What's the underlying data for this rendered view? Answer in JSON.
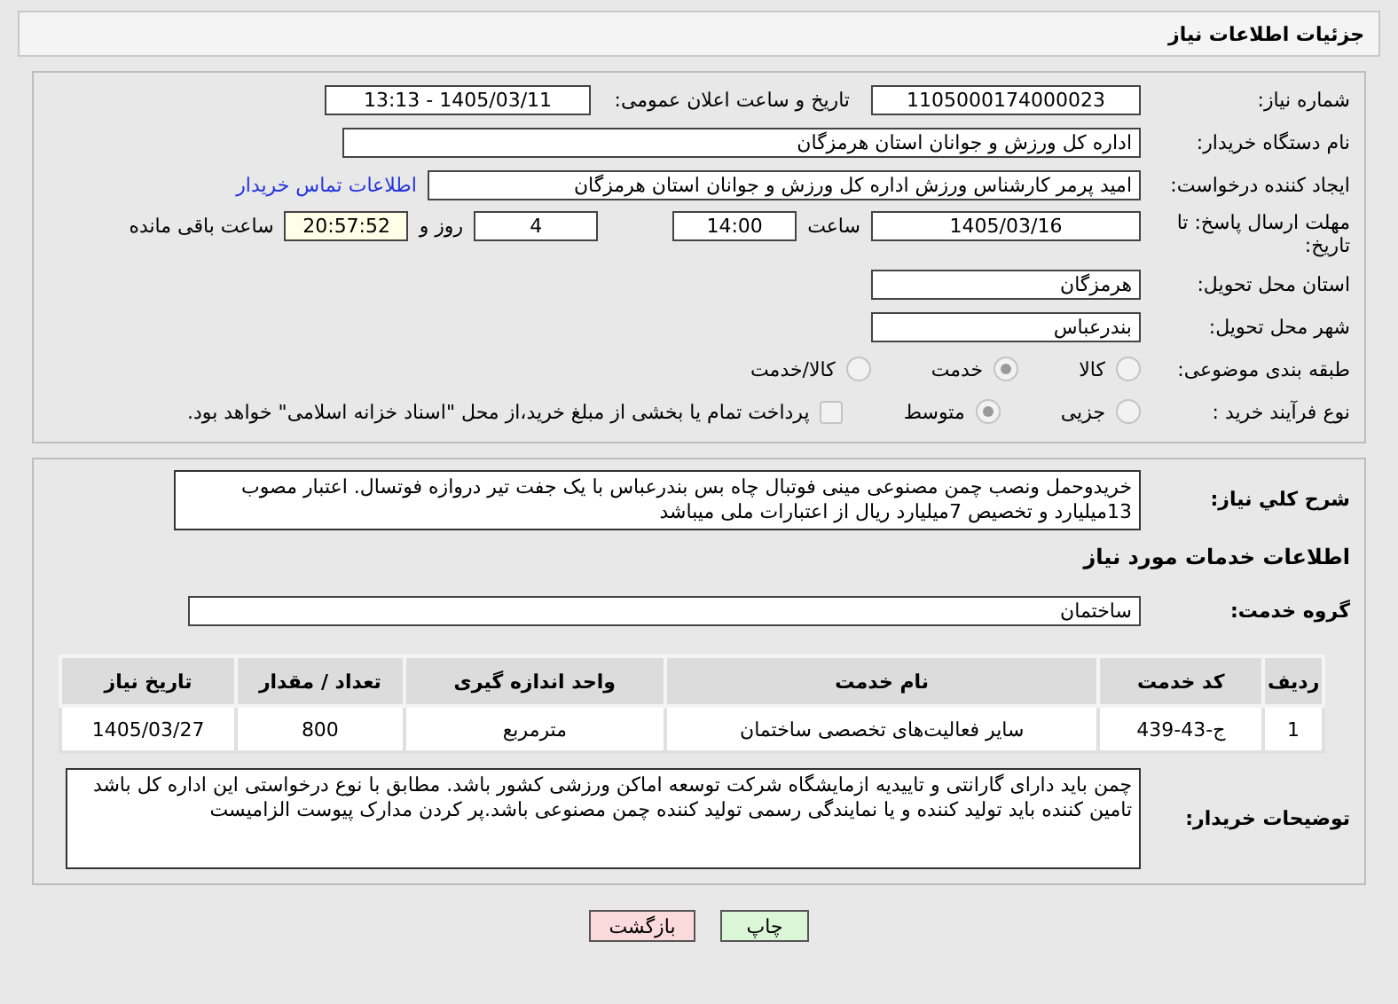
{
  "header": {
    "title": "جزئیات اطلاعات نیاز"
  },
  "need_number": {
    "label": "شماره نیاز:",
    "value": "1105000174000023"
  },
  "announce": {
    "label": "تاریخ و ساعت اعلان عمومی:",
    "value": "1405/03/11 - 13:13"
  },
  "buyer_org": {
    "label": "نام دستگاه خریدار:",
    "value": "اداره کل ورزش و جوانان استان هرمزگان"
  },
  "requester": {
    "label": "ایجاد کننده درخواست:",
    "value": "امید پرمر کارشناس ورزش اداره کل ورزش و جوانان استان هرمزگان",
    "link": "اطلاعات تماس خریدار"
  },
  "deadline": {
    "label": "مهلت ارسال پاسخ: تا تاریخ:",
    "date": "1405/03/16",
    "time_label": "ساعت",
    "time": "14:00",
    "days": "4",
    "days_label": "روز و",
    "remaining": "20:57:52",
    "remaining_label": "ساعت باقی مانده"
  },
  "province": {
    "label": "استان محل تحویل:",
    "value": "هرمزگان"
  },
  "city": {
    "label": "شهر محل تحویل:",
    "value": "بندرعباس"
  },
  "category": {
    "label": "طبقه بندی موضوعی:",
    "options": [
      {
        "label": "کالا",
        "selected": false
      },
      {
        "label": "خدمت",
        "selected": true
      },
      {
        "label": "کالا/خدمت",
        "selected": false
      }
    ]
  },
  "process": {
    "label": "نوع فرآیند خرید :",
    "options": [
      {
        "label": "جزیی",
        "selected": false
      },
      {
        "label": "متوسط",
        "selected": true
      }
    ],
    "payment": {
      "label": "پرداخت تمام یا بخشی از مبلغ خرید،از محل \"اسناد خزانه اسلامی\" خواهد بود.",
      "checked": false
    }
  },
  "summary": {
    "label": "شرح کلي نياز:",
    "value": "خریدوحمل ونصب چمن مصنوعی مینی فوتبال چاه بس بندرعباس با یک جفت تیر دروازه فوتسال. اعتبار مصوب 13میلیارد و تخصیص 7میلیارد ریال از اعتبارات ملی میباشد"
  },
  "services_heading": "اطلاعات خدمات مورد نياز",
  "service_group": {
    "label": "گروه خدمت:",
    "value": "ساختمان"
  },
  "table": {
    "columns": [
      "ردیف",
      "کد خدمت",
      "نام خدمت",
      "واحد اندازه گیری",
      "تعداد / مقدار",
      "تاریخ نیاز"
    ],
    "rows": [
      [
        "1",
        "ج-43-439",
        "سایر فعالیت‌های تخصصی ساختمان",
        "مترمربع",
        "800",
        "1405/03/27"
      ]
    ]
  },
  "notes": {
    "label": "توضیحات خریدار:",
    "value": "چمن باید دارای گارانتی و تاییدیه ازمایشگاه شرکت توسعه اماکن ورزشی کشور باشد. مطابق با نوع درخواستی این اداره کل باشد تامین کننده باید تولید کننده و یا نمایندگی رسمی تولید کننده چمن مصنوعی باشد.پر کردن مدارک پیوست الزامیست"
  },
  "buttons": [
    {
      "label": "چاپ",
      "kind": "print"
    },
    {
      "label": "بازگشت",
      "kind": "back"
    }
  ]
}
